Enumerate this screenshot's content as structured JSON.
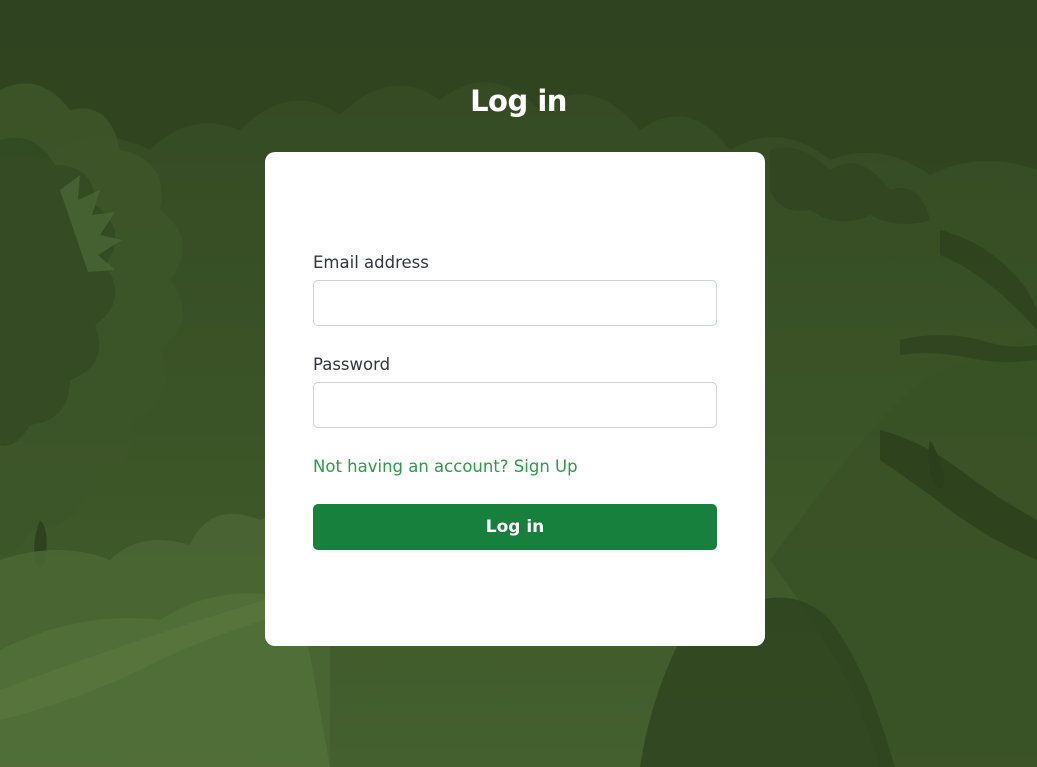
{
  "page": {
    "title": "Log in"
  },
  "form": {
    "email_label": "Email address",
    "email_value": "",
    "password_label": "Password",
    "password_value": "",
    "signup_link": "Not having an account? Sign Up",
    "submit_label": "Log in"
  },
  "colors": {
    "background": "#3a5226",
    "card": "#ffffff",
    "accent_button": "#17803d",
    "link": "#2e9a4a",
    "title_text": "#ffffff"
  },
  "icons": {
    "background_illustration": "forest-foliage-illustration"
  }
}
